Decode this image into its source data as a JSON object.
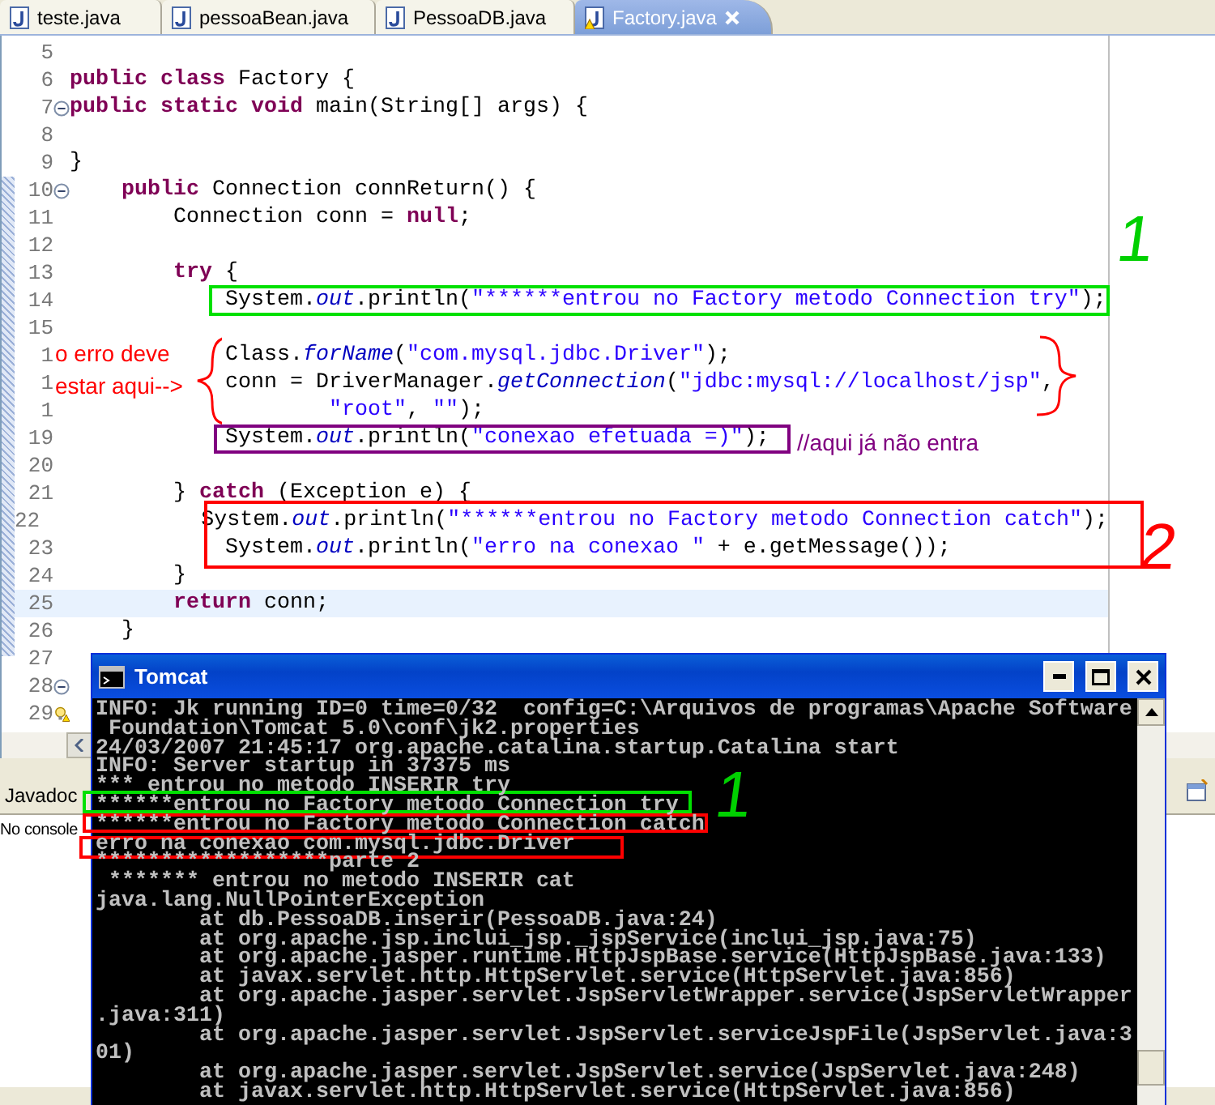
{
  "editor_tabs": [
    {
      "label": "teste.java",
      "selected": false,
      "warning": false
    },
    {
      "label": "pessoaBean.java",
      "selected": false,
      "warning": false
    },
    {
      "label": "PessoaDB.java",
      "selected": false,
      "warning": false
    },
    {
      "label": "Factory.java",
      "selected": true,
      "warning": true
    }
  ],
  "code_lines": [
    {
      "number": "5",
      "fold_marker": false,
      "warning": false
    },
    {
      "number": "6",
      "fold_marker": false,
      "warning": false,
      "tokens": [
        {
          "kind": "kw",
          "text": "public"
        },
        {
          "kind": "kw",
          "text": " class"
        },
        {
          "kind": "plain",
          "text": " Factory {"
        }
      ]
    },
    {
      "number": "7",
      "fold_marker": true,
      "warning": false,
      "tokens": [
        {
          "kind": "kw",
          "text": "public"
        },
        {
          "kind": "kw",
          "text": " static"
        },
        {
          "kind": "kw",
          "text": " void"
        },
        {
          "kind": "plain",
          "text": " main(String[] args) {"
        }
      ]
    },
    {
      "number": "8",
      "fold_marker": false,
      "warning": false
    },
    {
      "number": "9",
      "fold_marker": false,
      "warning": false,
      "tokens": [
        {
          "kind": "plain",
          "text": "}"
        }
      ]
    },
    {
      "number": "10",
      "fold_marker": true,
      "warning": false,
      "tokens": [
        {
          "kind": "kw",
          "text": "    public"
        },
        {
          "kind": "plain",
          "text": " Connection connReturn() {"
        }
      ]
    },
    {
      "number": "11",
      "fold_marker": false,
      "warning": false,
      "tokens": [
        {
          "kind": "plain",
          "text": "        Connection conn = "
        },
        {
          "kind": "kw",
          "text": "null"
        },
        {
          "kind": "plain",
          "text": ";"
        }
      ]
    },
    {
      "number": "12",
      "fold_marker": false,
      "warning": false
    },
    {
      "number": "13",
      "fold_marker": false,
      "warning": false,
      "tokens": [
        {
          "kind": "kw",
          "text": "        try"
        },
        {
          "kind": "plain",
          "text": " {"
        }
      ]
    },
    {
      "number": "14",
      "fold_marker": false,
      "warning": false,
      "tokens": [
        {
          "kind": "plain",
          "text": "            System."
        },
        {
          "kind": "field",
          "text": "out"
        },
        {
          "kind": "plain",
          "text": ".println("
        },
        {
          "kind": "str",
          "text": "\"******entrou no Factory metodo Connection try\""
        },
        {
          "kind": "plain",
          "text": ");"
        }
      ]
    },
    {
      "number": "15",
      "fold_marker": false,
      "warning": false
    },
    {
      "number": "1",
      "fold_marker": false,
      "warning": false,
      "tokens": [
        {
          "kind": "plain",
          "text": "            Class."
        },
        {
          "kind": "field",
          "text": "forName"
        },
        {
          "kind": "plain",
          "text": "("
        },
        {
          "kind": "str",
          "text": "\"com.mysql.jdbc.Driver\""
        },
        {
          "kind": "plain",
          "text": ");"
        }
      ]
    },
    {
      "number": "1",
      "fold_marker": false,
      "warning": false,
      "tokens": [
        {
          "kind": "plain",
          "text": "            conn = DriverManager."
        },
        {
          "kind": "field",
          "text": "getConnection"
        },
        {
          "kind": "plain",
          "text": "("
        },
        {
          "kind": "str",
          "text": "\"jdbc:mysql://localhost/jsp\""
        },
        {
          "kind": "plain",
          "text": ","
        }
      ]
    },
    {
      "number": "1",
      "fold_marker": false,
      "warning": false,
      "tokens": [
        {
          "kind": "str",
          "text": "                    \"root\""
        },
        {
          "kind": "plain",
          "text": ", "
        },
        {
          "kind": "str",
          "text": "\"\""
        },
        {
          "kind": "plain",
          "text": ");"
        }
      ]
    },
    {
      "number": "19",
      "fold_marker": false,
      "warning": false,
      "tokens": [
        {
          "kind": "plain",
          "text": "            System."
        },
        {
          "kind": "field",
          "text": "out"
        },
        {
          "kind": "plain",
          "text": ".println("
        },
        {
          "kind": "str",
          "text": "\"conexao efetuada =)\""
        },
        {
          "kind": "plain",
          "text": ");"
        }
      ]
    },
    {
      "number": "20",
      "fold_marker": false,
      "warning": false
    },
    {
      "number": "21",
      "fold_marker": false,
      "warning": false,
      "tokens": [
        {
          "kind": "plain",
          "text": "        } "
        },
        {
          "kind": "kw",
          "text": "catch"
        },
        {
          "kind": "plain",
          "text": " (Exception e) {"
        }
      ]
    },
    {
      "number": "22",
      "fold_marker": false,
      "warning": false,
      "tokens": [
        {
          "kind": "plain",
          "text": "            System."
        },
        {
          "kind": "field",
          "text": "out"
        },
        {
          "kind": "plain",
          "text": ".println("
        },
        {
          "kind": "str",
          "text": "\"******entrou no Factory metodo Connection catch\""
        },
        {
          "kind": "plain",
          "text": ");"
        }
      ]
    },
    {
      "number": "23",
      "fold_marker": false,
      "warning": false,
      "tokens": [
        {
          "kind": "plain",
          "text": "            System."
        },
        {
          "kind": "field",
          "text": "out"
        },
        {
          "kind": "plain",
          "text": ".println("
        },
        {
          "kind": "str",
          "text": "\"erro na conexao \""
        },
        {
          "kind": "plain",
          "text": " + e.getMessage());"
        }
      ]
    },
    {
      "number": "24",
      "fold_marker": false,
      "warning": false,
      "tokens": [
        {
          "kind": "plain",
          "text": "        }"
        }
      ]
    },
    {
      "number": "25",
      "fold_marker": false,
      "warning": false,
      "current": true,
      "tokens": [
        {
          "kind": "kw",
          "text": "        return"
        },
        {
          "kind": "plain",
          "text": " conn;"
        }
      ]
    },
    {
      "number": "26",
      "fold_marker": false,
      "warning": false,
      "tokens": [
        {
          "kind": "plain",
          "text": "    }"
        }
      ]
    },
    {
      "number": "27",
      "fold_marker": false,
      "warning": false
    },
    {
      "number": "28",
      "fold_marker": true,
      "warning": false
    },
    {
      "number": "29",
      "fold_marker": false,
      "warning": true
    }
  ],
  "annotations": [
    {
      "kind": "box",
      "color": "#00e000"
    },
    {
      "kind": "text",
      "color": "#00d000",
      "text": "1"
    },
    {
      "kind": "text",
      "color": "#ff0000",
      "text": "o erro deve estar aqui-->"
    },
    {
      "kind": "brace",
      "color": "#ff0000"
    },
    {
      "kind": "brace",
      "color": "#ff0000"
    },
    {
      "kind": "box",
      "color": "#800080"
    },
    {
      "kind": "text",
      "color": "#800080",
      "text": "//aqui já não entra"
    },
    {
      "kind": "box",
      "color": "#ff0000"
    },
    {
      "kind": "text",
      "color": "#ff0000",
      "text": "2"
    }
  ],
  "bottom_panel": {
    "tabs": [
      {
        "label": "Javadoc",
        "selected": false
      }
    ],
    "message": "No console"
  },
  "console_window": {
    "title": "Tomcat",
    "lines": [
      "INFO: Jk running ID=0 time=0/32  config=C:\\Arquivos de programas\\Apache Software",
      " Foundation\\Tomcat 5.0\\conf\\jk2.properties",
      "24/03/2007 21:45:17 org.apache.catalina.startup.Catalina start",
      "INFO: Server startup in 37375 ms",
      "*** entrou no metodo INSERIR try",
      "******entrou no Factory metodo Connection try",
      "******entrou no Factory metodo Connection catch",
      "erro na conexao com.mysql.jdbc.Driver",
      "******************parte 2",
      " ******* entrou no metodo INSERIR cat",
      "java.lang.NullPointerException",
      "        at db.PessoaDB.inserir(PessoaDB.java:24)",
      "        at org.apache.jsp.inclui_jsp._jspService(inclui_jsp.java:75)",
      "        at org.apache.jasper.runtime.HttpJspBase.service(HttpJspBase.java:133)",
      "        at javax.servlet.http.HttpServlet.service(HttpServlet.java:856)",
      "        at org.apache.jasper.servlet.JspServletWrapper.service(JspServletWrapper",
      ".java:311)",
      "        at org.apache.jasper.servlet.JspServlet.serviceJspFile(JspServlet.java:3",
      "01)",
      "        at org.apache.jasper.servlet.JspServlet.service(JspServlet.java:248)",
      "        at javax.servlet.http.HttpServlet.service(HttpServlet.java:856)"
    ],
    "annotations": [
      {
        "kind": "box",
        "color": "#00e000"
      },
      {
        "kind": "text",
        "color": "#00d000",
        "text": "1"
      },
      {
        "kind": "box",
        "color": "#ff0000"
      },
      {
        "kind": "box",
        "color": "#ff0000"
      }
    ]
  }
}
